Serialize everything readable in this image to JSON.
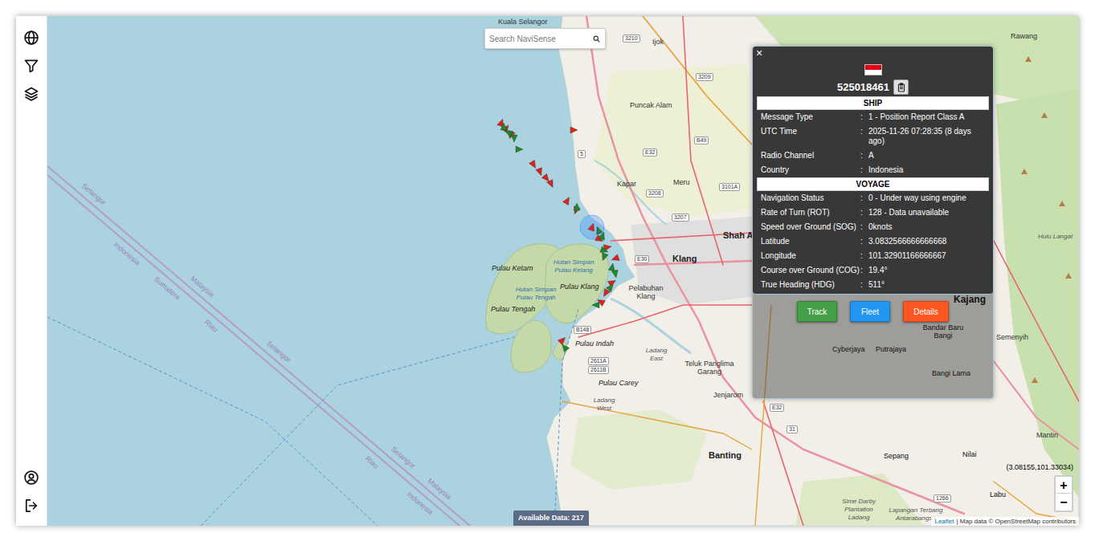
{
  "search": {
    "placeholder": "Search NaviSense"
  },
  "popup": {
    "close": "×",
    "mmsi": "525018461",
    "separator": ":",
    "sections": [
      {
        "title": "SHIP",
        "rows": [
          {
            "label": "Message Type",
            "value": "1 - Position Report Class A"
          },
          {
            "label": "UTC Time",
            "value": "2025-11-26 07:28:35 (8 days ago)"
          },
          {
            "label": "Radio Channel",
            "value": "A"
          },
          {
            "label": "Country",
            "value": "Indonesia"
          }
        ]
      },
      {
        "title": "VOYAGE",
        "rows": [
          {
            "label": "Navigation Status",
            "value": "0 - Under way using engine"
          },
          {
            "label": "Rate of Turn (ROT)",
            "value": "128 - Data unavailable"
          },
          {
            "label": "Speed over Ground (SOG)",
            "value": "0knots"
          },
          {
            "label": "Latitude",
            "value": "3.0832566666666668"
          },
          {
            "label": "Longitude",
            "value": "101.32901166666667"
          },
          {
            "label": "Course over Ground (COG)",
            "value": "19.4°"
          },
          {
            "label": "True Heading (HDG)",
            "value": "511°"
          }
        ]
      }
    ],
    "buttons": [
      {
        "label": "Track",
        "color": "#43a047"
      },
      {
        "label": "Fleet",
        "color": "#2196f3"
      },
      {
        "label": "Details",
        "color": "#ff5722"
      }
    ]
  },
  "map": {
    "labels": [
      {
        "text": "Kuala Selangor",
        "kind": "town"
      },
      {
        "text": "Rawang",
        "kind": "town"
      },
      {
        "text": "Ijok",
        "kind": "town"
      },
      {
        "text": "Puncak Alam",
        "kind": "town"
      },
      {
        "text": "Kapar",
        "kind": "town"
      },
      {
        "text": "Meru",
        "kind": "town"
      },
      {
        "text": "Shah A",
        "kind": "city"
      },
      {
        "text": "Klang",
        "kind": "city"
      },
      {
        "text": "Pelabuhan Klang",
        "kind": "town"
      },
      {
        "text": "Pulau Ketam",
        "kind": "island"
      },
      {
        "text": "Hutan Simpan Pulau Kelang",
        "kind": "forest"
      },
      {
        "text": "Pulau Klang",
        "kind": "island"
      },
      {
        "text": "Hutan Simpan Pulau Tengah",
        "kind": "forest"
      },
      {
        "text": "Pulau Tengah",
        "kind": "island"
      },
      {
        "text": "Pulau Indah",
        "kind": "island"
      },
      {
        "text": "Pulau Carey",
        "kind": "island"
      },
      {
        "text": "Ladang East",
        "kind": "estate"
      },
      {
        "text": "Ladang West",
        "kind": "estate"
      },
      {
        "text": "Teluk Panglima Garang",
        "kind": "town"
      },
      {
        "text": "Jenjarom",
        "kind": "town"
      },
      {
        "text": "Banting",
        "kind": "city"
      },
      {
        "text": "Sepang",
        "kind": "town"
      },
      {
        "text": "Nilai",
        "kind": "town"
      },
      {
        "text": "Mantin",
        "kind": "town"
      },
      {
        "text": "Labu",
        "kind": "town"
      },
      {
        "text": "Semenyih",
        "kind": "town"
      },
      {
        "text": "Hulu Langat",
        "kind": "estate"
      },
      {
        "text": "Sime Darby Plantation Ladang",
        "kind": "estate"
      },
      {
        "text": "Lapangan Terbang Antarabangsa",
        "kind": "estate"
      },
      {
        "text": "Kajang",
        "kind": "city"
      },
      {
        "text": "Bandar Baru Bangi",
        "kind": "town"
      },
      {
        "text": "Cyberjaya",
        "kind": "town"
      },
      {
        "text": "Putrajaya",
        "kind": "town"
      },
      {
        "text": "Bangi Lama",
        "kind": "town"
      },
      {
        "text": "3210",
        "kind": "road"
      },
      {
        "text": "3209",
        "kind": "road"
      },
      {
        "text": "B49",
        "kind": "road"
      },
      {
        "text": "E32",
        "kind": "road"
      },
      {
        "text": "3208",
        "kind": "road"
      },
      {
        "text": "3207",
        "kind": "road"
      },
      {
        "text": "3101A",
        "kind": "road"
      },
      {
        "text": "5",
        "kind": "road"
      },
      {
        "text": "E30",
        "kind": "road"
      },
      {
        "text": "B148",
        "kind": "road"
      },
      {
        "text": "2611A",
        "kind": "road"
      },
      {
        "text": "2611B",
        "kind": "road"
      },
      {
        "text": "E32",
        "kind": "road"
      },
      {
        "text": "31",
        "kind": "road"
      },
      {
        "text": "1266",
        "kind": "road"
      },
      {
        "text": "Selangor",
        "kind": "boundary"
      },
      {
        "text": "Indonesia",
        "kind": "boundary"
      },
      {
        "text": "Sumatera",
        "kind": "boundary"
      },
      {
        "text": "Malaysia",
        "kind": "boundary"
      },
      {
        "text": "Riau",
        "kind": "boundary"
      },
      {
        "text": "Selangor",
        "kind": "boundary"
      },
      {
        "text": "Selangor",
        "kind": "boundary"
      },
      {
        "text": "Riau",
        "kind": "boundary"
      },
      {
        "text": "Malaysia",
        "kind": "boundary"
      },
      {
        "text": "Indonesia",
        "kind": "boundary"
      }
    ],
    "ships": [
      {
        "color": "#e3201b",
        "selected": false
      },
      {
        "color": "#e3201b",
        "selected": false
      },
      {
        "color": "#e3201b",
        "selected": false
      },
      {
        "color": "#e3201b",
        "selected": false
      },
      {
        "color": "#e3201b",
        "selected": false
      },
      {
        "color": "#e3201b",
        "selected": false
      },
      {
        "color": "#e3201b",
        "selected": false
      },
      {
        "color": "#e3201b",
        "selected": false
      },
      {
        "color": "#e3201b",
        "selected": false
      },
      {
        "color": "#e3201b",
        "selected": false
      },
      {
        "color": "#e3201b",
        "selected": true
      },
      {
        "color": "#e3201b",
        "selected": false
      },
      {
        "color": "#e3201b",
        "selected": false
      },
      {
        "color": "#e3201b",
        "selected": false
      },
      {
        "color": "#e3201b",
        "selected": false
      },
      {
        "color": "#e3201b",
        "selected": false
      },
      {
        "color": "#e3201b",
        "selected": false
      },
      {
        "color": "#e3201b",
        "selected": false
      },
      {
        "color": "#1a8a2a",
        "selected": false
      },
      {
        "color": "#1a8a2a",
        "selected": false
      },
      {
        "color": "#1a8a2a",
        "selected": false
      },
      {
        "color": "#1a8a2a",
        "selected": false
      },
      {
        "color": "#1a8a2a",
        "selected": false
      },
      {
        "color": "#1a8a2a",
        "selected": false
      },
      {
        "color": "#1a8a2a",
        "selected": false
      },
      {
        "color": "#1a8a2a",
        "selected": false
      },
      {
        "color": "#1a8a2a",
        "selected": false
      },
      {
        "color": "#1a8a2a",
        "selected": false
      },
      {
        "color": "#1a8a2a",
        "selected": false
      },
      {
        "color": "#1a8a2a",
        "selected": false
      },
      {
        "color": "#1a8a2a",
        "selected": false
      },
      {
        "color": "#1a8a2a",
        "selected": false
      }
    ]
  },
  "zoom": {
    "in": "+",
    "out": "−"
  },
  "available_data": "Available Data: 217",
  "coordinates": "(3.08155,101.33034)",
  "attribution": {
    "link": "Leaflet",
    "text": "| Map data © OpenStreetMap contributors"
  }
}
